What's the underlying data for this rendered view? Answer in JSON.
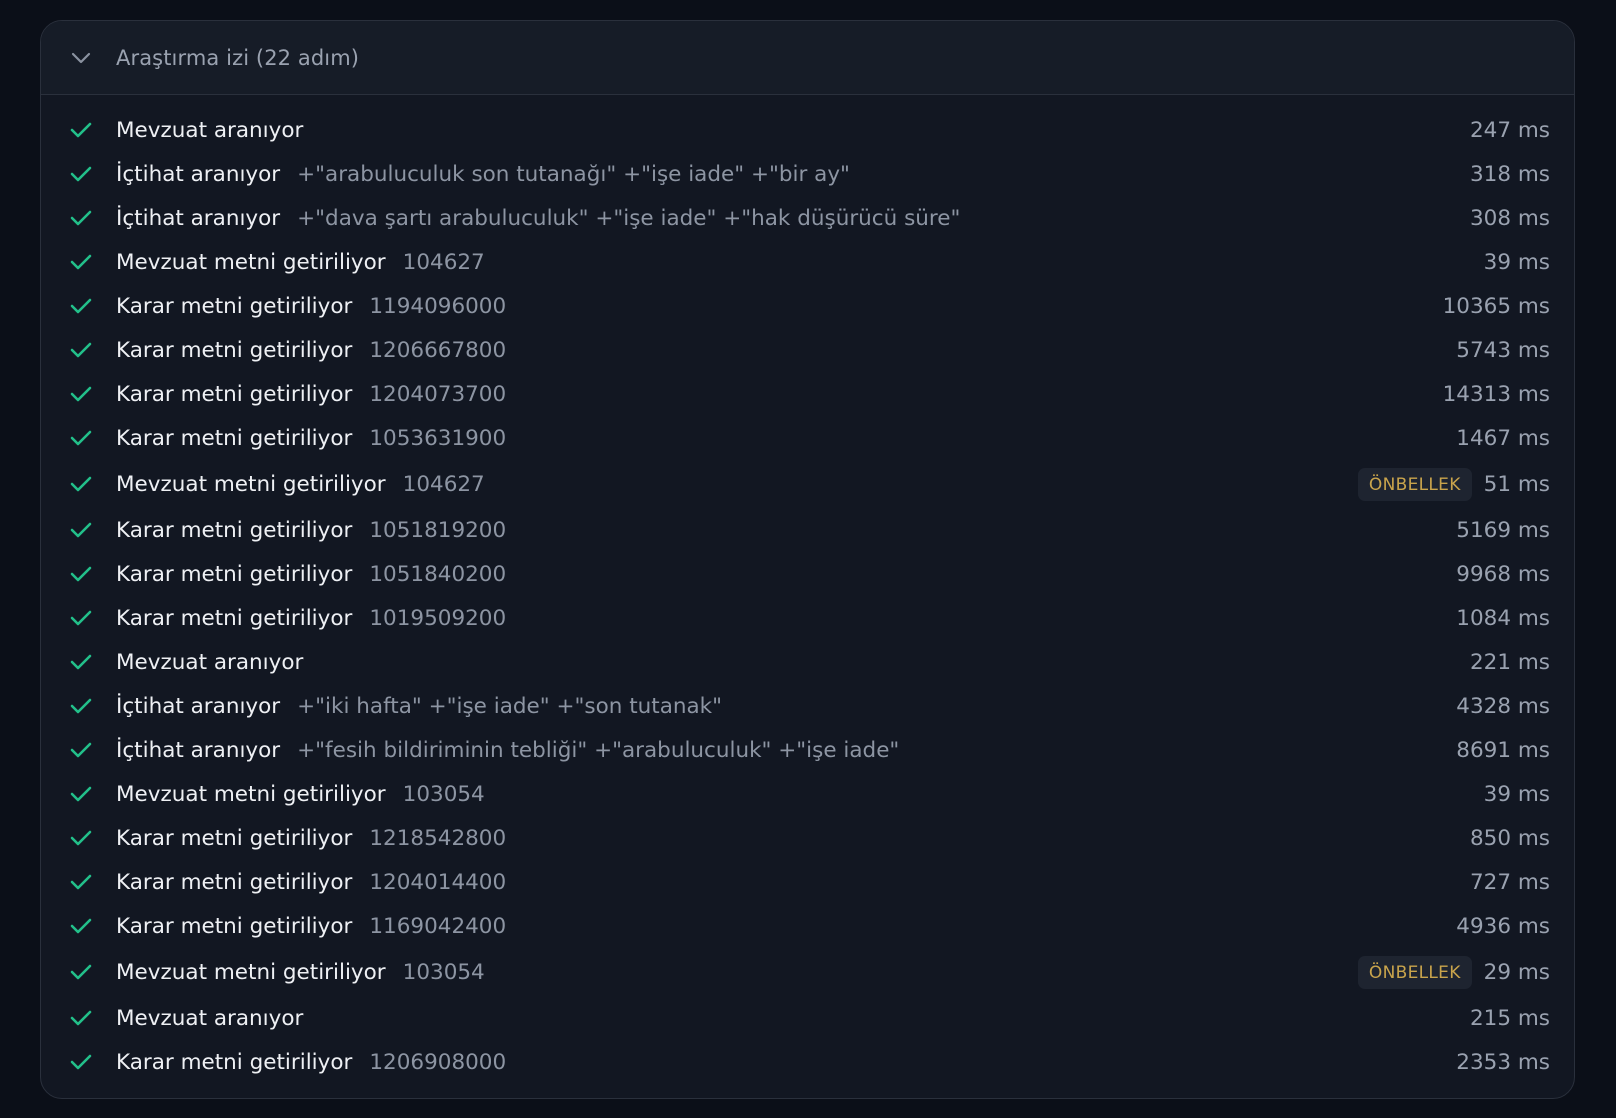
{
  "header": {
    "title": "Araştırma izi (22 adım)",
    "expanded": true
  },
  "colors": {
    "check": "#22c08a",
    "badge_text": "#c9a44c",
    "background": "#121722"
  },
  "steps": [
    {
      "label": "Mevzuat aranıyor",
      "detail": "",
      "badge": "",
      "duration": "247 ms"
    },
    {
      "label": "İçtihat aranıyor",
      "detail": "+\"arabuluculuk son tutanağı\" +\"işe iade\" +\"bir ay\"",
      "badge": "",
      "duration": "318 ms"
    },
    {
      "label": "İçtihat aranıyor",
      "detail": "+\"dava şartı arabuluculuk\" +\"işe iade\" +\"hak düşürücü süre\"",
      "badge": "",
      "duration": "308 ms"
    },
    {
      "label": "Mevzuat metni getiriliyor",
      "detail": "104627",
      "badge": "",
      "duration": "39 ms"
    },
    {
      "label": "Karar metni getiriliyor",
      "detail": "1194096000",
      "badge": "",
      "duration": "10365 ms"
    },
    {
      "label": "Karar metni getiriliyor",
      "detail": "1206667800",
      "badge": "",
      "duration": "5743 ms"
    },
    {
      "label": "Karar metni getiriliyor",
      "detail": "1204073700",
      "badge": "",
      "duration": "14313 ms"
    },
    {
      "label": "Karar metni getiriliyor",
      "detail": "1053631900",
      "badge": "",
      "duration": "1467 ms"
    },
    {
      "label": "Mevzuat metni getiriliyor",
      "detail": "104627",
      "badge": "ÖNBELLEK",
      "duration": "51 ms"
    },
    {
      "label": "Karar metni getiriliyor",
      "detail": "1051819200",
      "badge": "",
      "duration": "5169 ms"
    },
    {
      "label": "Karar metni getiriliyor",
      "detail": "1051840200",
      "badge": "",
      "duration": "9968 ms"
    },
    {
      "label": "Karar metni getiriliyor",
      "detail": "1019509200",
      "badge": "",
      "duration": "1084 ms"
    },
    {
      "label": "Mevzuat aranıyor",
      "detail": "",
      "badge": "",
      "duration": "221 ms"
    },
    {
      "label": "İçtihat aranıyor",
      "detail": "+\"iki hafta\" +\"işe iade\" +\"son tutanak\"",
      "badge": "",
      "duration": "4328 ms"
    },
    {
      "label": "İçtihat aranıyor",
      "detail": "+\"fesih bildiriminin tebliği\" +\"arabuluculuk\" +\"işe iade\"",
      "badge": "",
      "duration": "8691 ms"
    },
    {
      "label": "Mevzuat metni getiriliyor",
      "detail": "103054",
      "badge": "",
      "duration": "39 ms"
    },
    {
      "label": "Karar metni getiriliyor",
      "detail": "1218542800",
      "badge": "",
      "duration": "850 ms"
    },
    {
      "label": "Karar metni getiriliyor",
      "detail": "1204014400",
      "badge": "",
      "duration": "727 ms"
    },
    {
      "label": "Karar metni getiriliyor",
      "detail": "1169042400",
      "badge": "",
      "duration": "4936 ms"
    },
    {
      "label": "Mevzuat metni getiriliyor",
      "detail": "103054",
      "badge": "ÖNBELLEK",
      "duration": "29 ms"
    },
    {
      "label": "Mevzuat aranıyor",
      "detail": "",
      "badge": "",
      "duration": "215 ms"
    },
    {
      "label": "Karar metni getiriliyor",
      "detail": "1206908000",
      "badge": "",
      "duration": "2353 ms"
    }
  ]
}
